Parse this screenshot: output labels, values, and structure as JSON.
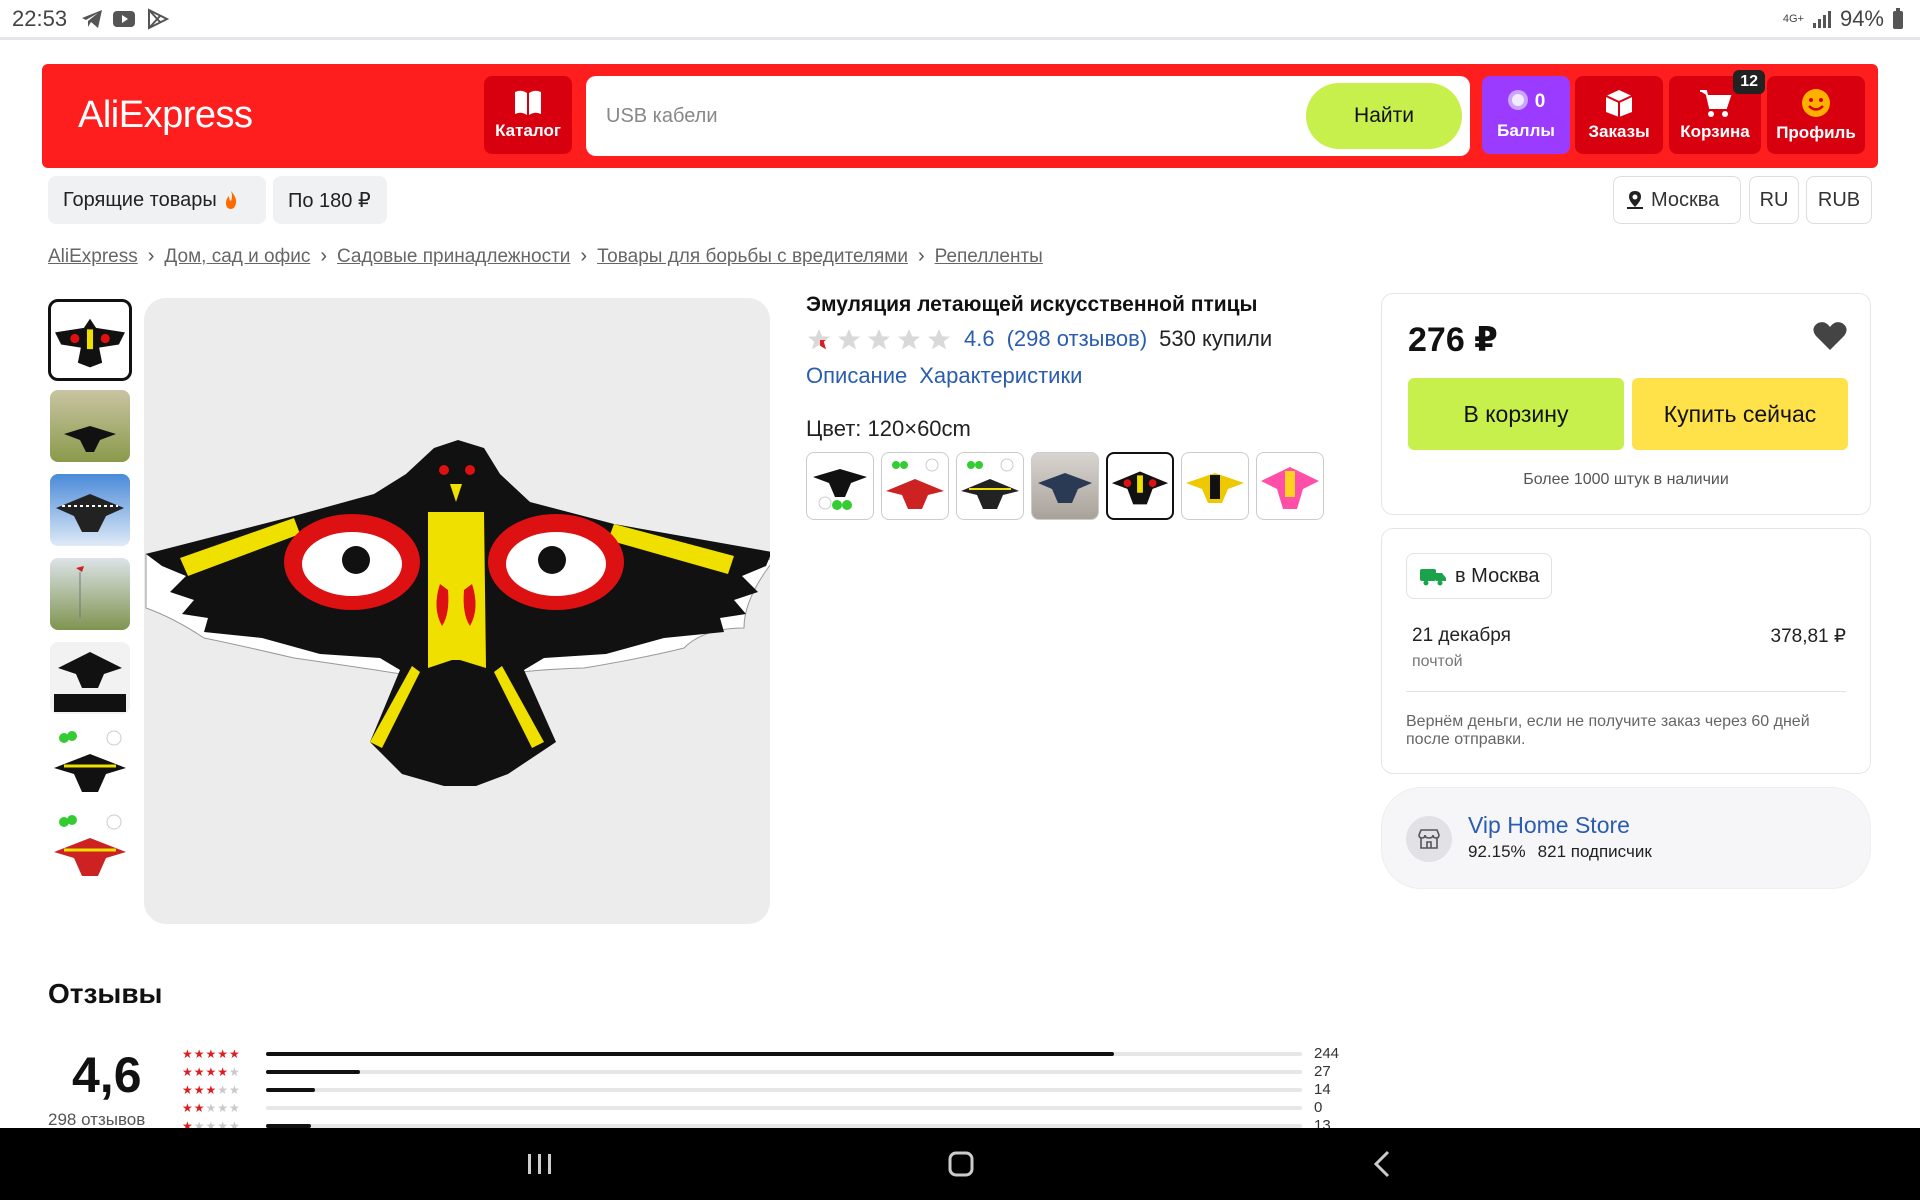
{
  "status_bar": {
    "time": "22:53",
    "network": "4G+",
    "battery": "94%"
  },
  "header": {
    "logo": "AliExpress",
    "catalog_label": "Каталог",
    "search_placeholder": "USB кабели",
    "search_button": "Найти",
    "points_count": "0",
    "points_label": "Баллы",
    "orders_label": "Заказы",
    "cart_label": "Корзина",
    "cart_badge": "12",
    "profile_label": "Профиль"
  },
  "pills": {
    "hot": "Горящие товары",
    "price": "По 180 ₽",
    "city": "Москва",
    "lang": "RU",
    "currency": "RUB"
  },
  "breadcrumbs": [
    "AliExpress",
    "Дом, сад и офис",
    "Садовые принадлежности",
    "Товары для борьбы с вредителями",
    "Репелленты"
  ],
  "product": {
    "title": "Эмуляция летающей искусственной птицы",
    "rating": "4.6",
    "rating_stars": 4.6,
    "reviews_link": "(298 отзывов)",
    "sold": "530 купили",
    "tab_description": "Описание",
    "tab_specs": "Характеристики",
    "color_label": "Цвет: 120×60cm",
    "selected_swatch_index": 4
  },
  "price_card": {
    "price": "276 ₽",
    "add_to_cart": "В корзину",
    "buy_now": "Купить сейчас",
    "stock": "Более 1000 штук в наличии"
  },
  "delivery": {
    "city": "в Москва",
    "date": "21 декабря",
    "method": "почтой",
    "price": "378,81 ₽",
    "refund": "Вернём деньги, если не получите заказ через 60 дней после отправки."
  },
  "store": {
    "name": "Vip Home Store",
    "rating": "92.15%",
    "followers": "821 подписчик"
  },
  "reviews": {
    "title": "Отзывы",
    "average": "4,6",
    "count": "298 отзывов",
    "distribution": [
      {
        "stars": 5,
        "count": "244",
        "value": 244
      },
      {
        "stars": 4,
        "count": "27",
        "value": 27
      },
      {
        "stars": 3,
        "count": "14",
        "value": 14
      },
      {
        "stars": 2,
        "count": "0",
        "value": 0
      },
      {
        "stars": 1,
        "count": "13",
        "value": 13
      }
    ]
  },
  "colors": {
    "brand_red": "#ff1e1e",
    "points_purple": "#9b3bff",
    "lime": "#c8f04c",
    "yellow": "#ffe14a",
    "link_blue": "#2a5db0"
  }
}
